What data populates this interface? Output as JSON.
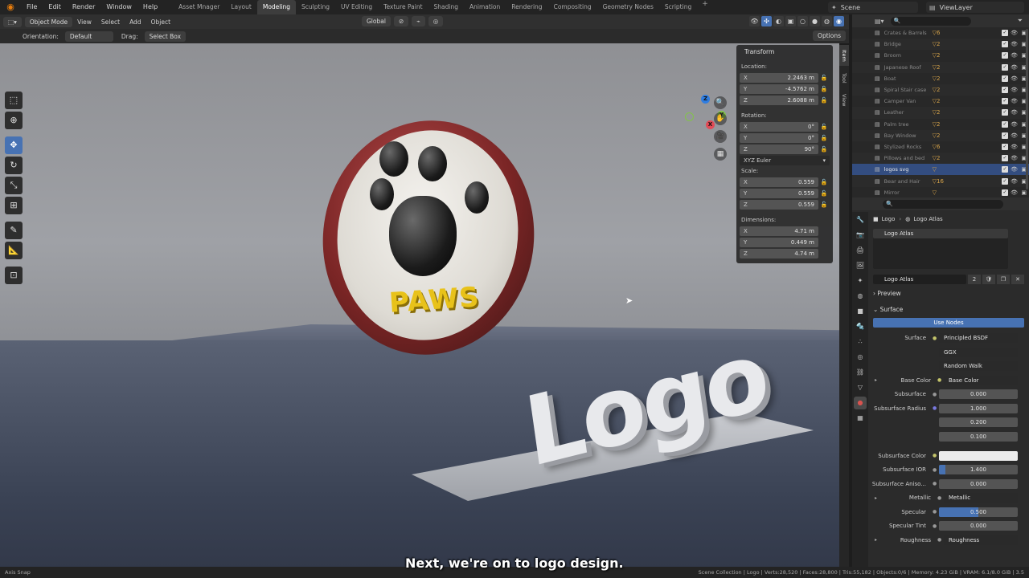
{
  "menubar": {
    "menus": [
      "File",
      "Edit",
      "Render",
      "Window",
      "Help"
    ],
    "workspaces": [
      "Asset Mnager",
      "Layout",
      "Modeling",
      "Sculpting",
      "UV Editing",
      "Texture Paint",
      "Shading",
      "Animation",
      "Rendering",
      "Compositing",
      "Geometry Nodes",
      "Scripting"
    ],
    "active_workspace": "Modeling",
    "scene": "Scene",
    "view_layer": "ViewLayer"
  },
  "viewport_header": {
    "mode": "Object Mode",
    "menus": [
      "View",
      "Select",
      "Add",
      "Object"
    ],
    "transform_orientation": "Global"
  },
  "tool_header": {
    "orientation_label": "Orientation:",
    "orientation_value": "Default",
    "drag_label": "Drag:",
    "drag_value": "Select Box",
    "options_label": "Options"
  },
  "scene_render": {
    "coin_text": "PAWS",
    "logo_text": "Logo"
  },
  "transform_panel": {
    "title": "Transform",
    "location_label": "Location:",
    "location": [
      {
        "axis": "X",
        "value": "2.2463 m"
      },
      {
        "axis": "Y",
        "value": "-4.5762 m"
      },
      {
        "axis": "Z",
        "value": "2.6088 m"
      }
    ],
    "rotation_label": "Rotation:",
    "rotation": [
      {
        "axis": "X",
        "value": "0°"
      },
      {
        "axis": "Y",
        "value": "0°"
      },
      {
        "axis": "Z",
        "value": "90°"
      }
    ],
    "rotation_mode": "XYZ Euler",
    "scale_label": "Scale:",
    "scale": [
      {
        "axis": "X",
        "value": "0.559"
      },
      {
        "axis": "Y",
        "value": "0.559"
      },
      {
        "axis": "Z",
        "value": "0.559"
      }
    ],
    "dimensions_label": "Dimensions:",
    "dimensions": [
      {
        "axis": "X",
        "value": "4.71 m"
      },
      {
        "axis": "Y",
        "value": "0.449 m"
      },
      {
        "axis": "Z",
        "value": "4.74 m"
      }
    ]
  },
  "side_tabs": [
    "Item",
    "Tool",
    "View"
  ],
  "outliner": {
    "items": [
      {
        "name": "Crates & Barrels",
        "badge": "▽6"
      },
      {
        "name": "Bridge",
        "badge": "▽2"
      },
      {
        "name": "Broom",
        "badge": "▽2"
      },
      {
        "name": "Japanese Roof",
        "badge": "▽2"
      },
      {
        "name": "Boat",
        "badge": "▽2"
      },
      {
        "name": "Spiral Stair case",
        "badge": "▽2"
      },
      {
        "name": "Camper Van",
        "badge": "▽2"
      },
      {
        "name": "Leather",
        "badge": "▽2"
      },
      {
        "name": "Palm tree",
        "badge": "▽2"
      },
      {
        "name": "Bay Window",
        "badge": "▽2"
      },
      {
        "name": "Stylized Rocks",
        "badge": "▽6"
      },
      {
        "name": "Pillows and bed",
        "badge": "▽2"
      },
      {
        "name": "logos svg",
        "badge": "▽"
      },
      {
        "name": "Bear and Hair",
        "badge": "▽16"
      },
      {
        "name": "Mirror",
        "badge": "▽"
      }
    ]
  },
  "properties": {
    "breadcrumb_object": "Logo",
    "breadcrumb_material": "Logo Atlas",
    "slot_name": "Logo Atlas",
    "material_name": "Logo Atlas",
    "material_users": "2",
    "preview_label": "Preview",
    "surface_section": "Surface",
    "use_nodes_label": "Use Nodes",
    "surface_label": "Surface",
    "surface_shader": "Principled BSDF",
    "distribution": "GGX",
    "subsurface_method": "Random Walk",
    "base_color_label": "Base Color",
    "base_color_value": "Base Color",
    "subsurface_label": "Subsurface",
    "subsurface_value": "0.000",
    "subsurface_radius_label": "Subsurface Radius",
    "subsurface_radius": [
      "1.000",
      "0.200",
      "0.100"
    ],
    "subsurface_color_label": "Subsurface Color",
    "subsurface_ior_label": "Subsurface IOR",
    "subsurface_ior_value": "1.400",
    "subsurface_ior_fill": 0.08,
    "subsurface_aniso_label": "Subsurface Aniso...",
    "subsurface_aniso_value": "0.000",
    "metallic_label": "Metallic",
    "metallic_value": "Metallic",
    "specular_label": "Specular",
    "specular_value": "0.500",
    "specular_fill": 0.5,
    "specular_tint_label": "Specular Tint",
    "specular_tint_value": "0.000",
    "roughness_label": "Roughness",
    "roughness_value": "Roughness"
  },
  "statusbar": {
    "left": "Axis Snap",
    "right": "Scene Collection | Logo | Verts:28,520 | Faces:28,800 | Tris:55,182 | Objects:0/6 | Memory: 4.23 GiB | VRAM: 6.1/8.0 GiB | 3.5"
  },
  "caption": "Next, we're on to logo design.",
  "colors": {
    "accent": "#4772b3",
    "coin_text": "#e8c21a",
    "blender_orange": "#e87d0d"
  }
}
